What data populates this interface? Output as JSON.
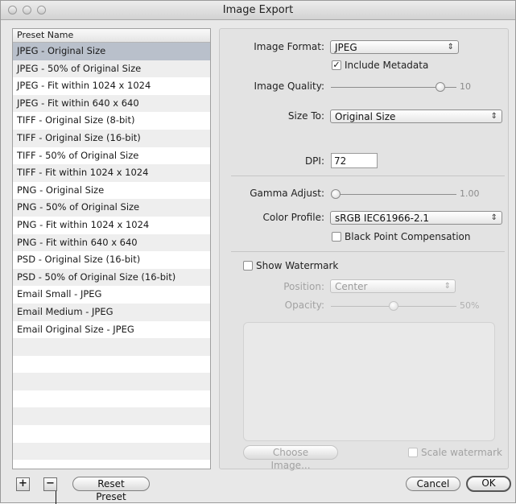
{
  "window": {
    "title": "Image Export"
  },
  "preset_list": {
    "header": "Preset Name",
    "selected_index": 0,
    "items": [
      "JPEG - Original Size",
      "JPEG - 50% of Original Size",
      "JPEG - Fit within 1024 x 1024",
      "JPEG - Fit within 640 x 640",
      "TIFF - Original Size (8-bit)",
      "TIFF - Original Size (16-bit)",
      "TIFF - 50% of Original Size",
      "TIFF - Fit within 1024 x 1024",
      "PNG - Original Size",
      "PNG - 50% of Original Size",
      "PNG - Fit within 1024 x 1024",
      "PNG - Fit within 640 x 640",
      "PSD - Original Size (16-bit)",
      "PSD - 50% of Original Size (16-bit)",
      "Email Small - JPEG",
      "Email Medium - JPEG",
      "Email Original Size - JPEG"
    ]
  },
  "settings": {
    "image_format_label": "Image Format:",
    "image_format_value": "JPEG",
    "include_metadata_label": "Include Metadata",
    "include_metadata_checked": true,
    "image_quality_label": "Image Quality:",
    "image_quality_value": "10",
    "image_quality_fraction": 0.9,
    "size_to_label": "Size To:",
    "size_to_value": "Original Size",
    "dpi_label": "DPI:",
    "dpi_value": "72",
    "gamma_label": "Gamma Adjust:",
    "gamma_value": "1.00",
    "gamma_fraction": 0.0,
    "color_profile_label": "Color Profile:",
    "color_profile_value": "sRGB IEC61966-2.1",
    "black_point_label": "Black Point Compensation",
    "black_point_checked": false,
    "watermark": {
      "show_label": "Show Watermark",
      "show_checked": false,
      "position_label": "Position:",
      "position_value": "Center",
      "opacity_label": "Opacity:",
      "opacity_value": "50%",
      "opacity_fraction": 0.5,
      "choose_image_label": "Choose Image...",
      "scale_label": "Scale watermark",
      "scale_checked": false
    }
  },
  "footer": {
    "add_symbol": "+",
    "remove_symbol": "−",
    "reset_label": "Reset Preset",
    "cancel_label": "Cancel",
    "ok_label": "OK"
  },
  "icons": {
    "popup_arrows": "⇕",
    "checkmark": "✓"
  }
}
